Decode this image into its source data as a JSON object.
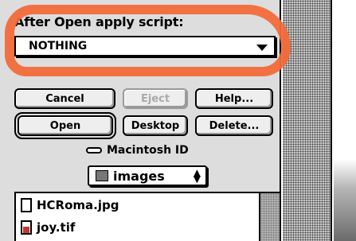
{
  "script_option": {
    "label": "After Open apply script:",
    "selected": "NOTHING"
  },
  "buttons": {
    "cancel": "Cancel",
    "eject": "Eject",
    "help": "Help...",
    "open": "Open",
    "desktop": "Desktop",
    "delete": "Delete..."
  },
  "volume": {
    "name": "Macintosh ID"
  },
  "folder_popup": {
    "selected": "images"
  },
  "files": [
    {
      "name": "HCRoma.jpg",
      "icon": "document-icon"
    },
    {
      "name": "joy.tif",
      "icon": "image-document-icon"
    }
  ],
  "colors": {
    "annotation": "#f26a3a"
  }
}
